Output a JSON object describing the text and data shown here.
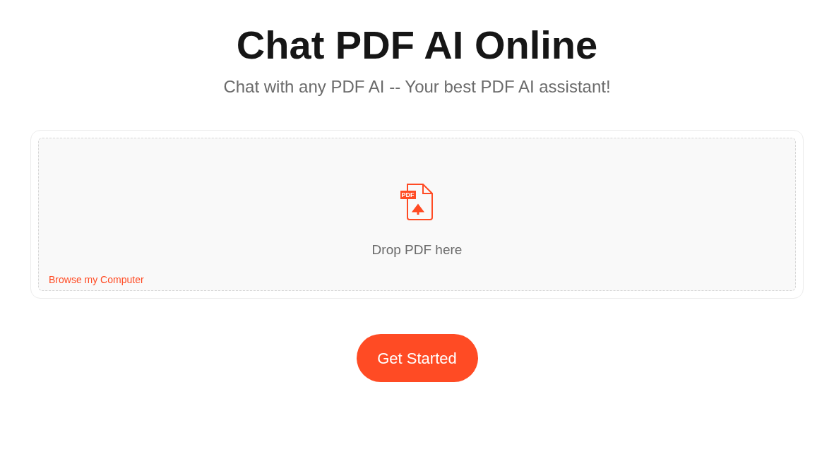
{
  "title": "Chat PDF AI Online",
  "subtitle": "Chat with any PDF AI -- Your best PDF AI assistant!",
  "upload": {
    "badge": "PDF",
    "prompt": "Drop PDF here",
    "browse_link": "Browse my Computer"
  },
  "button": "Get Started"
}
